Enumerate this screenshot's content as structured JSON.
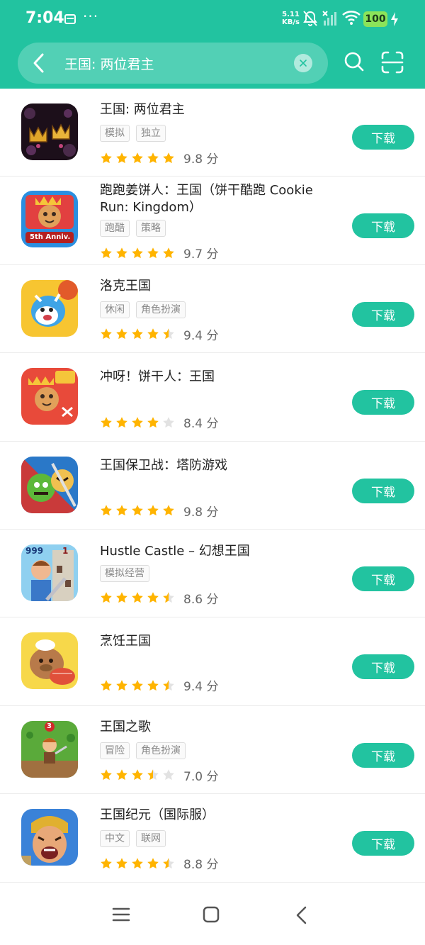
{
  "status": {
    "time": "7:04",
    "speed_line1": "5.11",
    "speed_line2": "KB/s",
    "battery": "100",
    "more": "···"
  },
  "search": {
    "query": "王国: 两位君主"
  },
  "colors": {
    "brand": "#22c3a0",
    "star": "#ffb400",
    "star_empty": "#e2e2e2"
  },
  "apps": [
    {
      "name": "王国: 两位君主",
      "tags": [
        "模拟",
        "独立"
      ],
      "stars": 5,
      "score": "9.8 分",
      "button": "下载"
    },
    {
      "name": "跑跑姜饼人：王国（饼干酷跑 Cookie Run: Kingdom）",
      "tags": [
        "跑酷",
        "策略"
      ],
      "stars": 5,
      "score": "9.7 分",
      "button": "下载"
    },
    {
      "name": "洛克王国",
      "tags": [
        "休闲",
        "角色扮演"
      ],
      "stars": 4.5,
      "score": "9.4 分",
      "button": "下载"
    },
    {
      "name": "冲呀！饼干人：王国",
      "tags": [],
      "stars": 4,
      "score": "8.4 分",
      "button": "下载"
    },
    {
      "name": "王国保卫战：塔防游戏",
      "tags": [],
      "stars": 5,
      "score": "9.8 分",
      "button": "下载"
    },
    {
      "name": "Hustle Castle – 幻想王国",
      "tags": [
        "模拟经营"
      ],
      "stars": 4.5,
      "score": "8.6 分",
      "button": "下载"
    },
    {
      "name": "烹饪王国",
      "tags": [],
      "stars": 4.5,
      "score": "9.4 分",
      "button": "下载"
    },
    {
      "name": "王国之歌",
      "tags": [
        "冒险",
        "角色扮演"
      ],
      "stars": 3.5,
      "score": "7.0 分",
      "button": "下载"
    },
    {
      "name": "王国纪元（国际服）",
      "tags": [
        "中文",
        "联网"
      ],
      "stars": 4.5,
      "score": "8.8 分",
      "button": "下载"
    }
  ],
  "icon_badges": {
    "cookie_run": "5th Anniv.",
    "hustle_left": "999",
    "hustle_right": "1",
    "kingdom_song": "3"
  }
}
